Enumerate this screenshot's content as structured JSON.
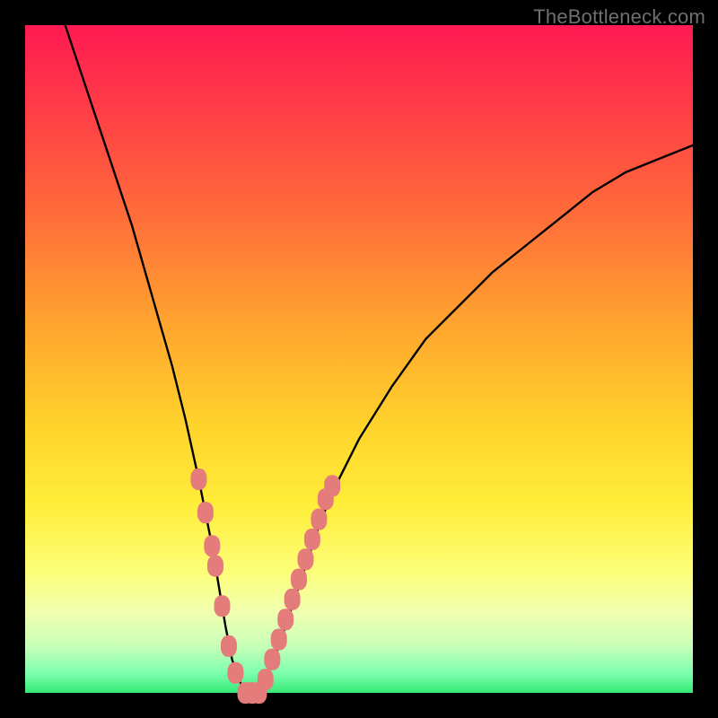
{
  "watermark": "TheBottleneck.com",
  "colors": {
    "frame": "#000000",
    "curve": "#000000",
    "marker_fill": "#e57c7c",
    "marker_stroke": "#d86666",
    "gradient_top": "#ff1a52",
    "gradient_bottom": "#36e876"
  },
  "chart_data": {
    "type": "line",
    "title": "",
    "xlabel": "",
    "ylabel": "",
    "xlim": [
      0,
      100
    ],
    "ylim": [
      0,
      100
    ],
    "grid": false,
    "series": [
      {
        "name": "bottleneck-curve",
        "x": [
          6,
          8,
          10,
          12,
          14,
          16,
          18,
          20,
          22,
          24,
          26,
          27,
          28,
          29,
          30,
          31,
          32,
          33,
          34,
          35,
          36,
          38,
          40,
          42,
          44,
          46,
          50,
          55,
          60,
          65,
          70,
          75,
          80,
          85,
          90,
          95,
          100
        ],
        "y": [
          100,
          94,
          88,
          82,
          76,
          70,
          63,
          56,
          49,
          41,
          32,
          27,
          22,
          16,
          10,
          5,
          2,
          0,
          0,
          0,
          2,
          7,
          13,
          19,
          25,
          30,
          38,
          46,
          53,
          58,
          63,
          67,
          71,
          75,
          78,
          80,
          82
        ]
      }
    ],
    "markers": [
      {
        "name": "left-scatter",
        "points": [
          {
            "x": 26,
            "y": 32
          },
          {
            "x": 27,
            "y": 27
          },
          {
            "x": 28,
            "y": 22
          },
          {
            "x": 28.5,
            "y": 19
          },
          {
            "x": 29.5,
            "y": 13
          },
          {
            "x": 30.5,
            "y": 7
          },
          {
            "x": 31.5,
            "y": 3
          },
          {
            "x": 33,
            "y": 0
          },
          {
            "x": 34,
            "y": 0
          },
          {
            "x": 35,
            "y": 0
          }
        ]
      },
      {
        "name": "right-scatter",
        "points": [
          {
            "x": 36,
            "y": 2
          },
          {
            "x": 37,
            "y": 5
          },
          {
            "x": 38,
            "y": 8
          },
          {
            "x": 39,
            "y": 11
          },
          {
            "x": 40,
            "y": 14
          },
          {
            "x": 41,
            "y": 17
          },
          {
            "x": 42,
            "y": 20
          },
          {
            "x": 43,
            "y": 23
          },
          {
            "x": 44,
            "y": 26
          },
          {
            "x": 45,
            "y": 29
          },
          {
            "x": 46,
            "y": 31
          }
        ]
      }
    ]
  }
}
